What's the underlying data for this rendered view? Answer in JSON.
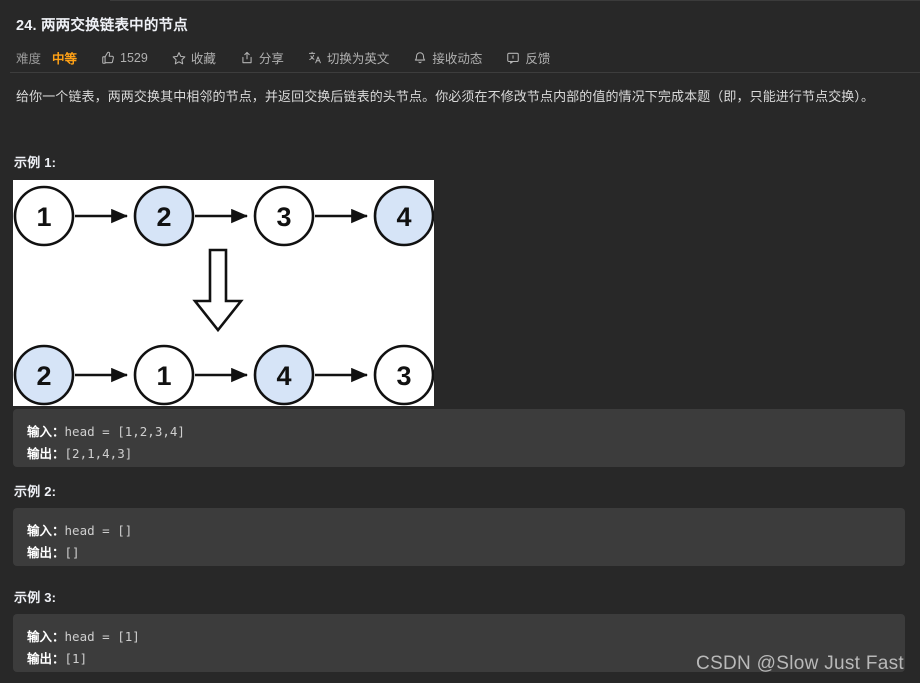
{
  "header": {
    "title": "24. 两两交换链表中的节点",
    "meta": {
      "difficulty_label": "难度",
      "difficulty_value": "中等",
      "difficulty_color": "#ffa116",
      "likes": "1529",
      "favorite_label": "收藏",
      "share_label": "分享",
      "translate_label": "切换为英文",
      "subscribe_label": "接收动态",
      "feedback_label": "反馈",
      "icons": {
        "like": "thumbs-up-icon",
        "favorite": "star-icon",
        "share": "share-icon",
        "translate": "translate-icon",
        "subscribe": "bell-icon",
        "feedback": "feedback-icon"
      }
    }
  },
  "description": "给你一个链表，两两交换其中相邻的节点，并返回交换后链表的头节点。你必须在不修改节点内部的值的情况下完成本题（即，只能进行节点交换）。",
  "examples": [
    {
      "label": "示例 1:",
      "input_label": "输入：",
      "input_value": "head = [1,2,3,4]",
      "output_label": "输出：",
      "output_value": "[2,1,4,3]"
    },
    {
      "label": "示例 2:",
      "input_label": "输入：",
      "input_value": "head = []",
      "output_label": "输出：",
      "output_value": "[]"
    },
    {
      "label": "示例 3:",
      "input_label": "输入：",
      "input_value": "head = [1]",
      "output_label": "输出：",
      "output_value": "[1]"
    }
  ],
  "diagram": {
    "alt": "linked-list-swap-diagram",
    "node_fill_highlight": "#d6e4f7",
    "node_fill_plain": "#ffffff",
    "node_stroke": "#000000",
    "before_row": [
      {
        "value": "1",
        "highlight": false
      },
      {
        "value": "2",
        "highlight": true
      },
      {
        "value": "3",
        "highlight": false
      },
      {
        "value": "4",
        "highlight": true
      }
    ],
    "after_row": [
      {
        "value": "2",
        "highlight": true
      },
      {
        "value": "1",
        "highlight": false
      },
      {
        "value": "4",
        "highlight": true
      },
      {
        "value": "3",
        "highlight": false
      }
    ]
  },
  "watermark": "CSDN @Slow Just Fast"
}
